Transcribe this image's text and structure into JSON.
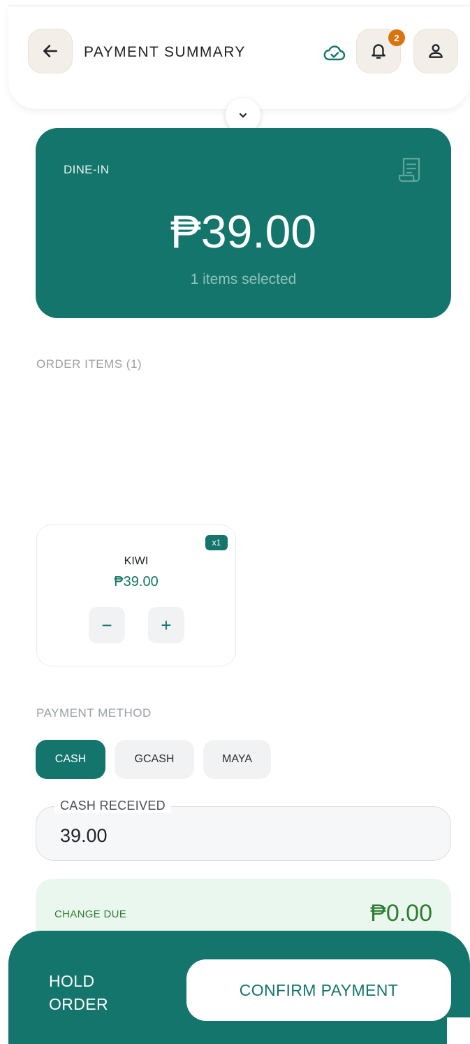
{
  "header": {
    "title": "PAYMENT SUMMARY",
    "notification_count": "2",
    "icons": [
      "back-arrow-icon",
      "cloud-check-icon",
      "bell-icon",
      "user-icon",
      "chevron-down-icon"
    ]
  },
  "summary": {
    "order_type": "DINE-IN",
    "total": "₱39.00",
    "items_selected": "1 items selected",
    "icon": "receipt-icon"
  },
  "order_items": {
    "label": "ORDER ITEMS (1)",
    "items": [
      {
        "name": "KIWI",
        "price": "₱39.00",
        "quantity_tag": "x1",
        "minus_label": "−",
        "plus_label": "+"
      }
    ]
  },
  "payment": {
    "label": "PAYMENT METHOD",
    "methods": [
      "CASH",
      "GCASH",
      "MAYA"
    ],
    "selected": "CASH",
    "cash_received_label": "CASH RECEIVED",
    "cash_received_value": "39.00",
    "change_due_label": "CHANGE DUE",
    "change_due_value": "₱0.00"
  },
  "footer": {
    "hold_label": "HOLD ORDER",
    "confirm_label": "CONFIRM PAYMENT"
  },
  "colors": {
    "primary": "#13756b",
    "badge": "#d9740f",
    "change_green": "#2e7d32",
    "change_bg": "#eaf7ee"
  }
}
